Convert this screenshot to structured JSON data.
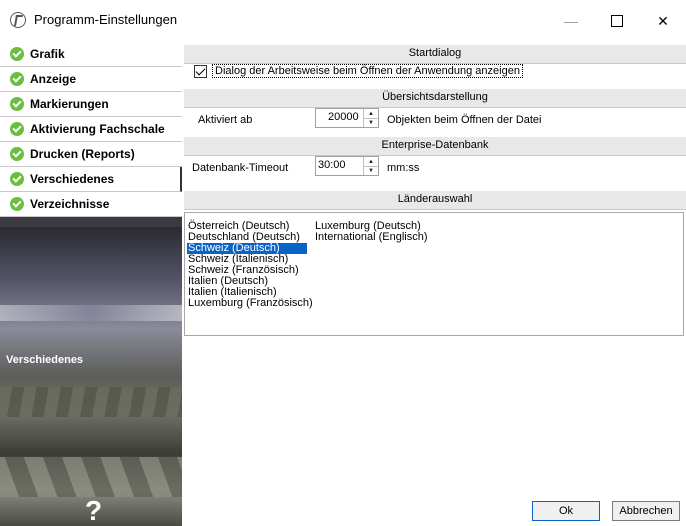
{
  "window": {
    "title": "Programm-Einstellungen",
    "min": "—",
    "close": "✕"
  },
  "sidebar": {
    "items": [
      {
        "label": "Grafik"
      },
      {
        "label": "Anzeige"
      },
      {
        "label": "Markierungen"
      },
      {
        "label": "Aktivierung Fachschale"
      },
      {
        "label": "Drucken (Reports)"
      },
      {
        "label": "Verschiedenes"
      },
      {
        "label": "Verzeichnisse"
      }
    ],
    "selected": "Verschiedenes",
    "scene_label": "Verschiedenes",
    "help": "?"
  },
  "startdialog": {
    "header": "Startdialog",
    "checkbox_label": "Dialog der Arbeitsweise beim Öffnen der Anwendung anzeigen",
    "checked": true
  },
  "uebersicht": {
    "header": "Übersichtsdarstellung",
    "label": "Aktiviert ab",
    "value": "20000",
    "suffix": "Objekten beim Öffnen der Datei"
  },
  "enterprise": {
    "header": "Enterprise-Datenbank",
    "label": "Datenbank-Timeout",
    "value": "30:00",
    "suffix": "mm:ss"
  },
  "laender": {
    "header": "Länderauswahl",
    "col1": [
      "Österreich (Deutsch)",
      "Deutschland (Deutsch)",
      "Schweiz (Deutsch)",
      "Schweiz (Italienisch)",
      "Schweiz (Französisch)",
      "Italien (Deutsch)",
      "Italien (Italienisch)",
      "Luxemburg (Französisch)"
    ],
    "col2": [
      "Luxemburg (Deutsch)",
      "International (Englisch)"
    ],
    "selected": "Schweiz (Deutsch)"
  },
  "buttons": {
    "ok": "Ok",
    "cancel": "Abbrechen"
  },
  "colors": {
    "selection": "#0a64c8",
    "check_green": "#6bbf3d"
  }
}
